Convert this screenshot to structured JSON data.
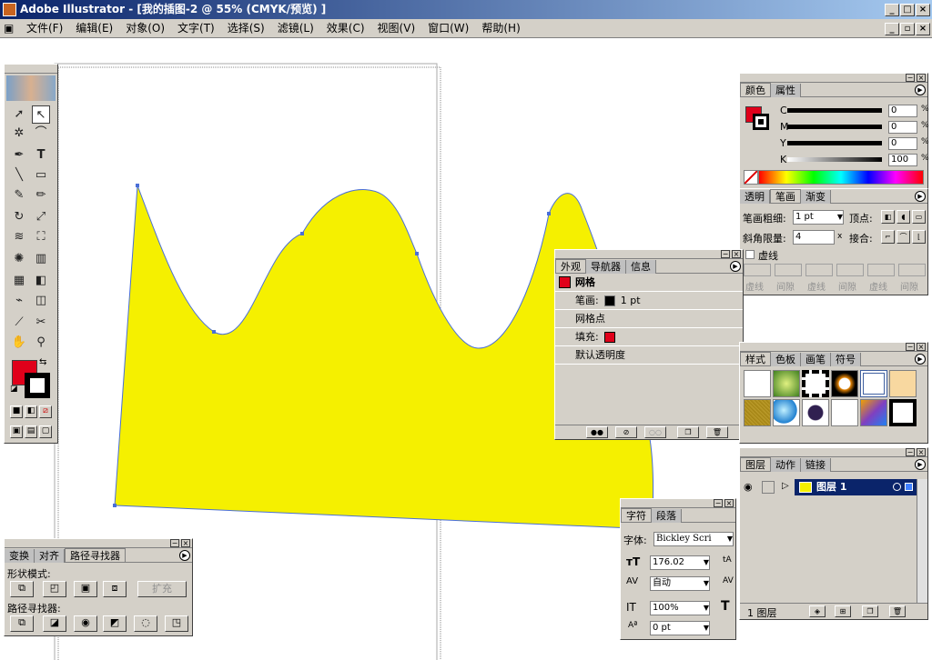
{
  "window": {
    "title": "Adobe Illustrator - [我的插图-2 @ 55% (CMYK/预览) ]"
  },
  "menu": [
    "文件(F)",
    "编辑(E)",
    "对象(O)",
    "文字(T)",
    "选择(S)",
    "滤镜(L)",
    "效果(C)",
    "视图(V)",
    "窗口(W)",
    "帮助(H)"
  ],
  "colors": {
    "fill": "#e0001a",
    "shape": "#f5f000",
    "outline": "#4a6fd8",
    "selection": "#0a246a"
  },
  "color_panel": {
    "tabs": [
      "颜色",
      "属性"
    ],
    "channels": [
      {
        "label": "C",
        "value": "0",
        "unit": "%"
      },
      {
        "label": "M",
        "value": "0",
        "unit": "%"
      },
      {
        "label": "Y",
        "value": "0",
        "unit": "%"
      },
      {
        "label": "K",
        "value": "100",
        "unit": "%"
      }
    ]
  },
  "stroke_panel": {
    "tabs": [
      "透明",
      "笔画",
      "渐变"
    ],
    "weight_label": "笔画粗细:",
    "weight_value": "1 pt",
    "cap_label": "顶点:",
    "miter_label": "斜角限量:",
    "miter_value": "4",
    "miter_unit": "x",
    "join_label": "接合:",
    "dashed_label": "虚线",
    "dash_labels": [
      "虚线",
      "间隙",
      "虚线",
      "间隙",
      "虚线",
      "间隙"
    ]
  },
  "appearance_panel": {
    "tabs": [
      "外观",
      "导航器",
      "信息"
    ],
    "object_label": "网格",
    "stroke_label": "笔画:",
    "stroke_value": "1 pt",
    "mesh_point": "网格点",
    "fill_label": "填充:",
    "opacity": "默认透明度"
  },
  "swatches_panel": {
    "tabs": [
      "样式",
      "色板",
      "画笔",
      "符号"
    ]
  },
  "layers_panel": {
    "tabs": [
      "图层",
      "动作",
      "链接"
    ],
    "layer_name": "图层 1",
    "count": "1 图层"
  },
  "character_panel": {
    "tabs": [
      "字符",
      "段落"
    ],
    "font_label": "字体:",
    "font_value": "Bickley Scri",
    "size_value": "176.02",
    "leading_value": "自动",
    "scale_value": "100%",
    "baseline_value": "0 pt"
  },
  "pathfinder_panel": {
    "tabs": [
      "变换",
      "对齐",
      "路径寻找器"
    ],
    "shape_modes": "形状模式:",
    "expand": "扩充",
    "pathfinders": "路径寻找器:"
  }
}
